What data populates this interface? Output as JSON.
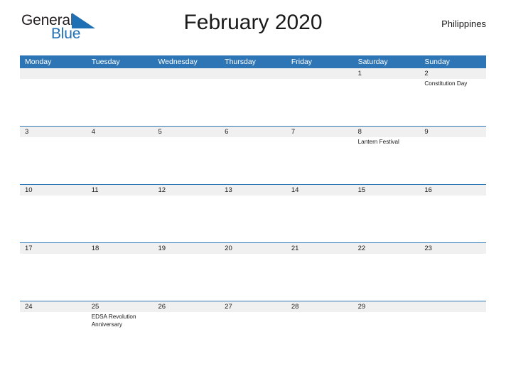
{
  "brand": {
    "name_part1": "General",
    "name_part2": "Blue",
    "flag_icon": "blue-triangle-flag-icon",
    "accent_color": "#1f6fb5"
  },
  "header": {
    "title": "February 2020",
    "country": "Philippines"
  },
  "calendar": {
    "month": "February",
    "year": "2020",
    "header_bg": "#2E75B6",
    "date_band_bg": "#F0F0F0",
    "row_divider_color": "#2E75B6",
    "weekdays": [
      "Monday",
      "Tuesday",
      "Wednesday",
      "Thursday",
      "Friday",
      "Saturday",
      "Sunday"
    ],
    "weeks": [
      {
        "days": [
          {
            "num": "",
            "events": []
          },
          {
            "num": "",
            "events": []
          },
          {
            "num": "",
            "events": []
          },
          {
            "num": "",
            "events": []
          },
          {
            "num": "",
            "events": []
          },
          {
            "num": "1",
            "events": []
          },
          {
            "num": "2",
            "events": [
              "Constitution Day"
            ]
          }
        ]
      },
      {
        "days": [
          {
            "num": "3",
            "events": []
          },
          {
            "num": "4",
            "events": []
          },
          {
            "num": "5",
            "events": []
          },
          {
            "num": "6",
            "events": []
          },
          {
            "num": "7",
            "events": []
          },
          {
            "num": "8",
            "events": [
              "Lantern Festival"
            ]
          },
          {
            "num": "9",
            "events": []
          }
        ]
      },
      {
        "days": [
          {
            "num": "10",
            "events": []
          },
          {
            "num": "11",
            "events": []
          },
          {
            "num": "12",
            "events": []
          },
          {
            "num": "13",
            "events": []
          },
          {
            "num": "14",
            "events": []
          },
          {
            "num": "15",
            "events": []
          },
          {
            "num": "16",
            "events": []
          }
        ]
      },
      {
        "days": [
          {
            "num": "17",
            "events": []
          },
          {
            "num": "18",
            "events": []
          },
          {
            "num": "19",
            "events": []
          },
          {
            "num": "20",
            "events": []
          },
          {
            "num": "21",
            "events": []
          },
          {
            "num": "22",
            "events": []
          },
          {
            "num": "23",
            "events": []
          }
        ]
      },
      {
        "days": [
          {
            "num": "24",
            "events": []
          },
          {
            "num": "25",
            "events": [
              "EDSA Revolution",
              "Anniversary"
            ]
          },
          {
            "num": "26",
            "events": []
          },
          {
            "num": "27",
            "events": []
          },
          {
            "num": "28",
            "events": []
          },
          {
            "num": "29",
            "events": []
          },
          {
            "num": "",
            "events": []
          }
        ]
      }
    ]
  }
}
